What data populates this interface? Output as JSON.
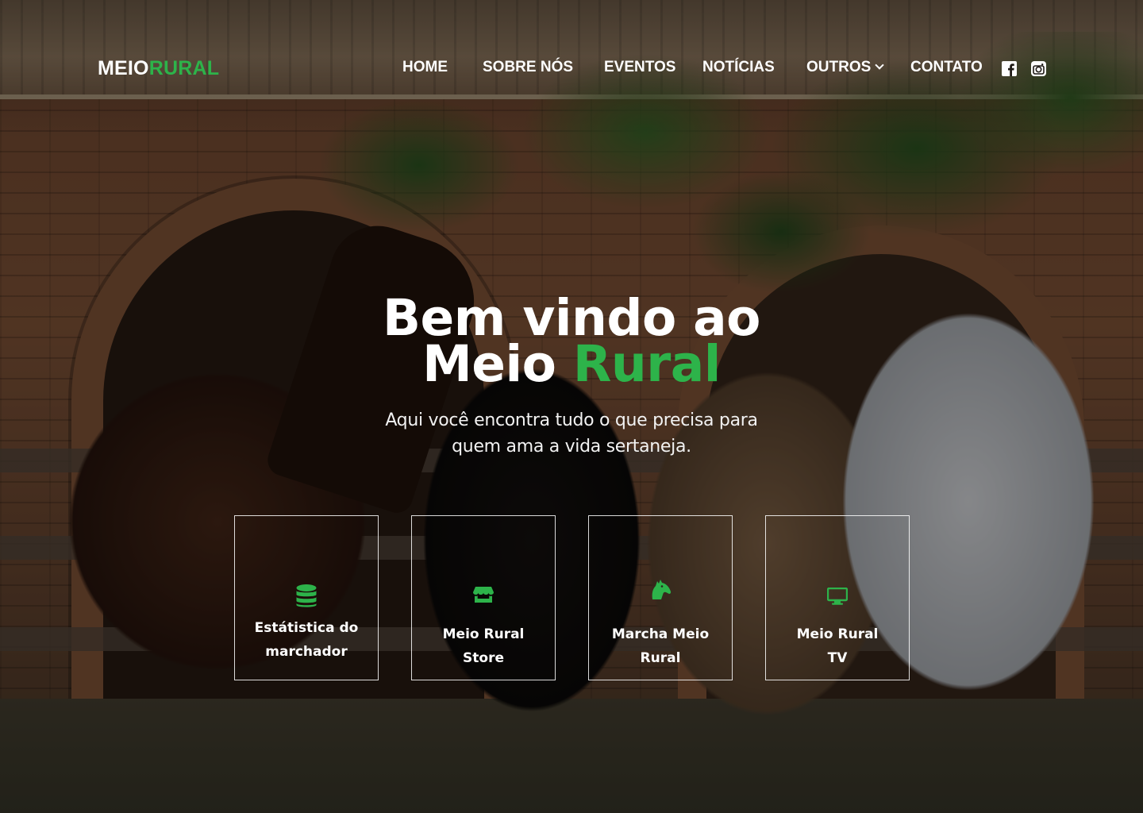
{
  "brand": {
    "logo_part1": "MEIO",
    "logo_part2": "RURAL",
    "accent_color": "#2db34a"
  },
  "nav": {
    "items": [
      {
        "label": "HOME"
      },
      {
        "label": "SOBRE NÓS"
      },
      {
        "label": "EVENTOS"
      },
      {
        "label": "NOTÍCIAS"
      },
      {
        "label": "OUTROS",
        "has_dropdown": true
      },
      {
        "label": "CONTATO"
      }
    ],
    "social": [
      {
        "icon": "facebook-icon"
      },
      {
        "icon": "instagram-icon"
      }
    ]
  },
  "hero": {
    "title_line1": "Bem vindo ao",
    "title_line2_a": "Meio ",
    "title_line2_b": "Rural",
    "subtitle_line1": "Aqui você encontra tudo o que precisa para",
    "subtitle_line2": "quem ama a vida sertaneja."
  },
  "cards": [
    {
      "icon": "database-icon",
      "line1": "Estátistica do",
      "line2": "marchador"
    },
    {
      "icon": "store-icon",
      "line1": "Meio Rural",
      "line2": "Store"
    },
    {
      "icon": "horse-head-icon",
      "line1": "Marcha Meio",
      "line2": "Rural"
    },
    {
      "icon": "monitor-icon",
      "line1": "Meio Rural",
      "line2": "TV"
    }
  ]
}
